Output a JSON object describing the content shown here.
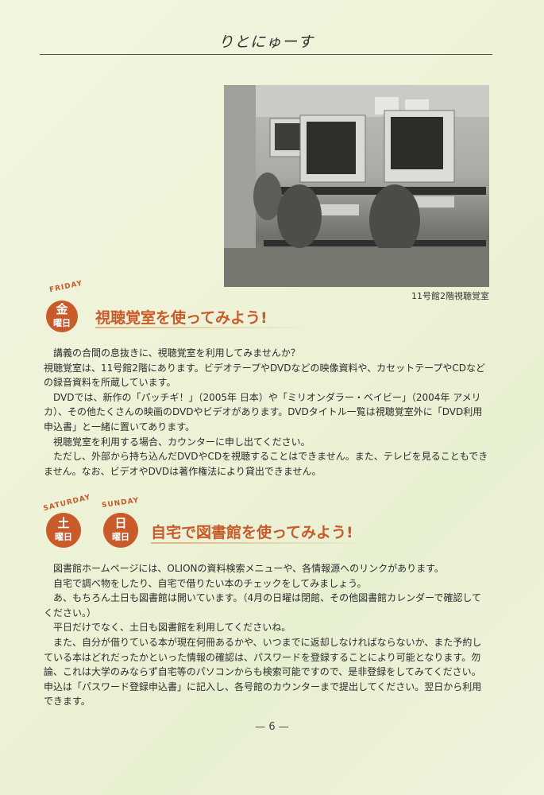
{
  "header": {
    "title": "りとにゅーす"
  },
  "photo": {
    "caption": "11号館2階視聴覚室"
  },
  "section1": {
    "day_en": "FRIDAY",
    "badge": {
      "line1": "金",
      "line2": "曜日"
    },
    "title": "視聴覚室を使ってみよう!",
    "paragraphs": [
      "講義の合間の息抜きに、視聴覚室を利用してみませんか？",
      "視聴覚室は、11号館2階にあります。ビデオテープやDVDなどの映像資料や、カセットテープやCDなどの録音資料を所蔵しています。",
      "DVDでは、新作の「パッチギ！」（2005年 日本）や「ミリオンダラー・ベイビー」（2004年 アメリカ）、その他たくさんの映画のDVDやビデオがあります。DVDタイトル一覧は視聴覚室外に「DVD利用申込書」と一緒に置いてあります。",
      "視聴覚室を利用する場合、カウンターに申し出てください。",
      "ただし、外部から持ち込んだDVDやCDを視聴することはできません。また、テレビを見ることもできません。なお、ビデオやDVDは著作権法により貸出できません。"
    ]
  },
  "section2": {
    "day_en_1": "SATURDAY",
    "day_en_2": "SUNDAY",
    "badge1": {
      "line1": "土",
      "line2": "曜日"
    },
    "badge2": {
      "line1": "日",
      "line2": "曜日"
    },
    "title": "自宅で図書館を使ってみよう!",
    "paragraphs": [
      "図書館ホームページには、OLIONの資料検索メニューや、各情報源へのリンクがあります。",
      "自宅で調べ物をしたり、自宅で借りたい本のチェックをしてみましょう。",
      "あ、もちろん土日も図書館は開いています。（4月の日曜は閉館、その他図書館カレンダーで確認してください。）",
      "平日だけでなく、土日も図書館を利用してくださいね。",
      "また、自分が借りている本が現在何冊あるかや、いつまでに返却しなければならないか、また予約している本はどれだったかといった情報の確認は、パスワードを登録することにより可能となります。勿論、これは大学のみならず自宅等のパソコンからも検索可能ですので、是非登録をしてみてください。申込は「パスワード登録申込書」に記入し、各号館のカウンターまで提出してください。翌日から利用できます。"
    ]
  },
  "footer": {
    "page_number": "— 6 —"
  }
}
